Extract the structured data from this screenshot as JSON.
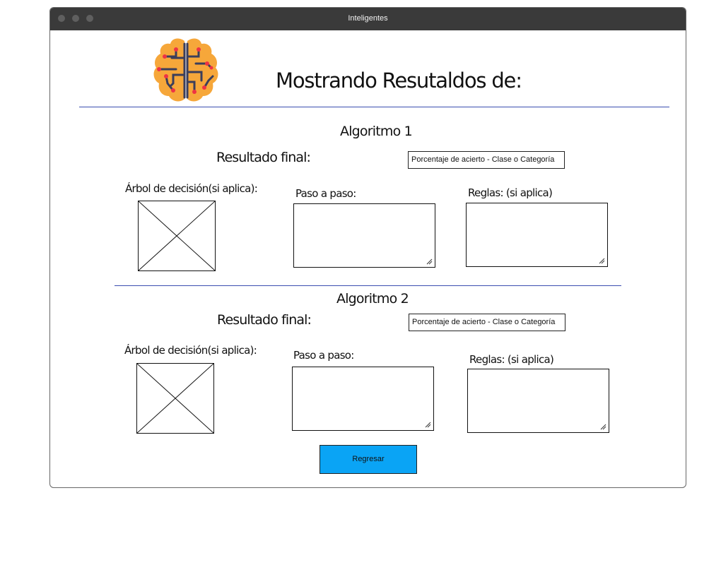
{
  "window": {
    "title": "Inteligentes"
  },
  "header": {
    "logo_icon": "brain-circuit-icon",
    "heading": "Mostrando Resutaldos de:"
  },
  "algorithms": [
    {
      "title": "Algoritmo 1",
      "result_label": "Resultado final:",
      "result_value": "Porcentaje de acierto - Clase o Categoría",
      "tree_label": "Árbol de decisión(si aplica):",
      "steps_label": "Paso a paso:",
      "rules_label": "Reglas: (si aplica)"
    },
    {
      "title": "Algoritmo 2",
      "result_label": "Resultado final:",
      "result_value": "Porcentaje de acierto - Clase o Categoría",
      "tree_label": "Árbol de decisión(si aplica):",
      "steps_label": "Paso a paso:",
      "rules_label": "Reglas: (si aplica)"
    }
  ],
  "actions": {
    "back_label": "Regresar"
  },
  "colors": {
    "titlebar": "#3a3a3a",
    "divider": "#3a4db0",
    "button": "#0aa4f5",
    "logo_orange": "#f6a73a",
    "logo_circuit": "#3b3e5b",
    "logo_node": "#ee3344"
  }
}
